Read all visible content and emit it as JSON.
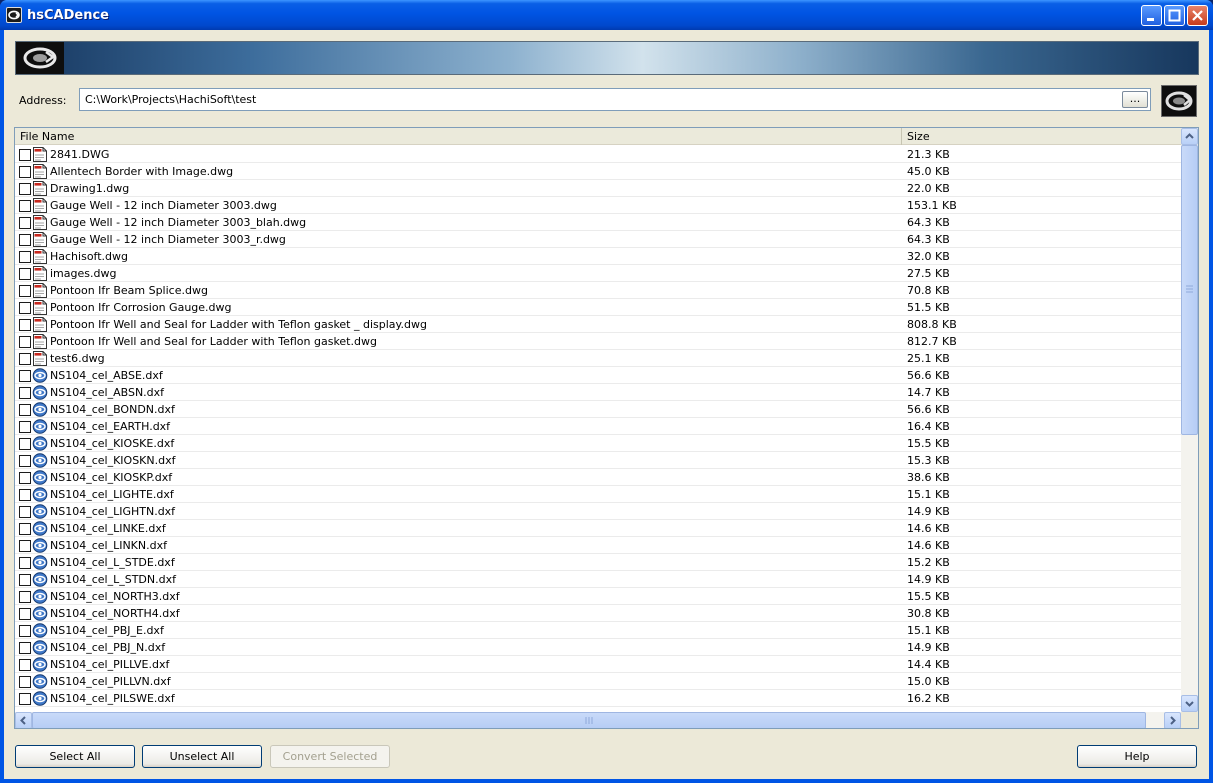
{
  "window": {
    "title": "hsCADence"
  },
  "address": {
    "label": "Address:",
    "value": "C:\\Work\\Projects\\HachiSoft\\test",
    "browse_label": "..."
  },
  "columns": {
    "name": "File Name",
    "size": "Size"
  },
  "files": [
    {
      "name": "2841.DWG",
      "size": "21.3 KB",
      "icon": "dwg-file-icon"
    },
    {
      "name": "Allentech Border with Image.dwg",
      "size": "45.0 KB",
      "icon": "dwg-file-icon"
    },
    {
      "name": "Drawing1.dwg",
      "size": "22.0 KB",
      "icon": "dwg-file-icon"
    },
    {
      "name": "Gauge Well - 12 inch Diameter 3003.dwg",
      "size": "153.1 KB",
      "icon": "dwg-file-icon"
    },
    {
      "name": "Gauge Well - 12 inch Diameter 3003_blah.dwg",
      "size": "64.3 KB",
      "icon": "dwg-file-icon"
    },
    {
      "name": "Gauge Well - 12 inch Diameter 3003_r.dwg",
      "size": "64.3 KB",
      "icon": "dwg-file-icon"
    },
    {
      "name": "Hachisoft.dwg",
      "size": "32.0 KB",
      "icon": "dwg-file-icon"
    },
    {
      "name": "images.dwg",
      "size": "27.5 KB",
      "icon": "dwg-file-icon"
    },
    {
      "name": "Pontoon Ifr Beam Splice.dwg",
      "size": "70.8 KB",
      "icon": "dwg-file-icon"
    },
    {
      "name": "Pontoon Ifr Corrosion Gauge.dwg",
      "size": "51.5 KB",
      "icon": "dwg-file-icon"
    },
    {
      "name": "Pontoon Ifr Well and Seal for Ladder with Teflon gasket _ display.dwg",
      "size": "808.8 KB",
      "icon": "dwg-file-icon"
    },
    {
      "name": "Pontoon Ifr Well and Seal for Ladder with Teflon gasket.dwg",
      "size": "812.7 KB",
      "icon": "dwg-file-icon"
    },
    {
      "name": "test6.dwg",
      "size": "25.1 KB",
      "icon": "dwg-file-icon"
    },
    {
      "name": "NS104_cel_ABSE.dxf",
      "size": "56.6 KB",
      "icon": "dxf-file-icon"
    },
    {
      "name": "NS104_cel_ABSN.dxf",
      "size": "14.7 KB",
      "icon": "dxf-file-icon"
    },
    {
      "name": "NS104_cel_BONDN.dxf",
      "size": "56.6 KB",
      "icon": "dxf-file-icon"
    },
    {
      "name": "NS104_cel_EARTH.dxf",
      "size": "16.4 KB",
      "icon": "dxf-file-icon"
    },
    {
      "name": "NS104_cel_KIOSKE.dxf",
      "size": "15.5 KB",
      "icon": "dxf-file-icon"
    },
    {
      "name": "NS104_cel_KIOSKN.dxf",
      "size": "15.3 KB",
      "icon": "dxf-file-icon"
    },
    {
      "name": "NS104_cel_KIOSKP.dxf",
      "size": "38.6 KB",
      "icon": "dxf-file-icon"
    },
    {
      "name": "NS104_cel_LIGHTE.dxf",
      "size": "15.1 KB",
      "icon": "dxf-file-icon"
    },
    {
      "name": "NS104_cel_LIGHTN.dxf",
      "size": "14.9 KB",
      "icon": "dxf-file-icon"
    },
    {
      "name": "NS104_cel_LINKE.dxf",
      "size": "14.6 KB",
      "icon": "dxf-file-icon"
    },
    {
      "name": "NS104_cel_LINKN.dxf",
      "size": "14.6 KB",
      "icon": "dxf-file-icon"
    },
    {
      "name": "NS104_cel_L_STDE.dxf",
      "size": "15.2 KB",
      "icon": "dxf-file-icon"
    },
    {
      "name": "NS104_cel_L_STDN.dxf",
      "size": "14.9 KB",
      "icon": "dxf-file-icon"
    },
    {
      "name": "NS104_cel_NORTH3.dxf",
      "size": "15.5 KB",
      "icon": "dxf-file-icon"
    },
    {
      "name": "NS104_cel_NORTH4.dxf",
      "size": "30.8 KB",
      "icon": "dxf-file-icon"
    },
    {
      "name": "NS104_cel_PBJ_E.dxf",
      "size": "15.1 KB",
      "icon": "dxf-file-icon"
    },
    {
      "name": "NS104_cel_PBJ_N.dxf",
      "size": "14.9 KB",
      "icon": "dxf-file-icon"
    },
    {
      "name": "NS104_cel_PILLVE.dxf",
      "size": "14.4 KB",
      "icon": "dxf-file-icon"
    },
    {
      "name": "NS104_cel_PILLVN.dxf",
      "size": "15.0 KB",
      "icon": "dxf-file-icon"
    },
    {
      "name": "NS104_cel_PILSWE.dxf",
      "size": "16.2 KB",
      "icon": "dxf-file-icon"
    }
  ],
  "buttons": {
    "select_all": "Select All",
    "unselect_all": "Unselect All",
    "convert_selected": "Convert Selected",
    "help": "Help"
  },
  "colors": {
    "titlebar": "#0054e3",
    "window_bg": "#ece9d8",
    "scrollbar_thumb": "#b6cdf5"
  }
}
